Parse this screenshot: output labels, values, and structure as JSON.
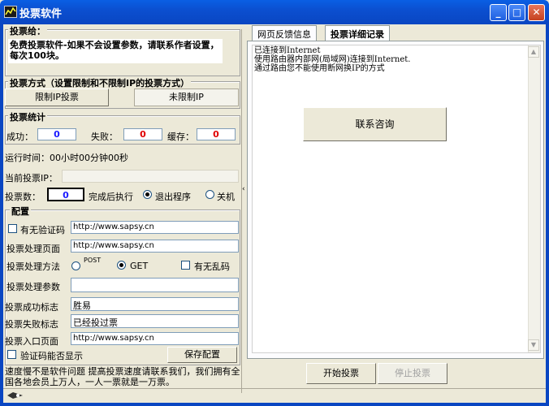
{
  "window": {
    "title": "投票软件"
  },
  "notice": {
    "heading": "投票给：",
    "text": "免费投票软件-如果不会设置参数，请联系作者设置，每次100块。"
  },
  "mode": {
    "heading": "投票方式（设置限制和不限制IP的投票方式）",
    "limited_label": "限制IP投票",
    "unlimited_label": "未限制IP"
  },
  "stats": {
    "heading": "投票统计",
    "success_label": "成功：",
    "success_value": "0",
    "fail_label": "失败：",
    "fail_value": "0",
    "cache_label": "缓存：",
    "cache_value": "0"
  },
  "runtime": "运行时间：00小时00分钟00秒",
  "current_ip_label": "当前投票IP：",
  "vote_count": {
    "label": "投票数：",
    "value": "0",
    "after_label": "完成后执行",
    "exit_label": "退出程序",
    "shutdown_label": "关机"
  },
  "config": {
    "heading": "配置",
    "captcha_label": "有无验证码",
    "captcha_url": "http://www.sapsy.cn",
    "page_label": "投票处理页面",
    "page_url": "http://www.sapsy.cn",
    "method_label": "投票处理方法",
    "post_label": "POST",
    "get_label": "GET",
    "garble_label": "有无乱码",
    "params_label": "投票处理参数",
    "params_value": "",
    "success_flag_label": "投票成功标志",
    "success_flag_value": "胜易",
    "fail_flag_label": "投票失败标志",
    "fail_flag_value": "已经投过票",
    "entry_label": "投票入口页面",
    "entry_url": "http://www.sapsy.cn",
    "captcha_show_label": "验证码能否显示",
    "save_label": "保存配置"
  },
  "footer_text": "速度慢不是软件问题 提高投票速度请联系我们，我们拥有全国各地会员上万人，一人一票就是一万票。",
  "tabs": [
    {
      "label": "网页反馈信息"
    },
    {
      "label": "投票详细记录"
    }
  ],
  "log_lines": [
    "已连接到Internet",
    "使用路由器内部网(局域网)连接到Internet.",
    "通过路由您不能使用断网换IP的方式"
  ],
  "consult_label": "联系咨询",
  "start_label": "开始投票",
  "stop_label": "停止投票",
  "colors": {
    "titlebar": "#0a46c2",
    "count_blue": "#1a1aff",
    "count_red": "#e00000"
  }
}
